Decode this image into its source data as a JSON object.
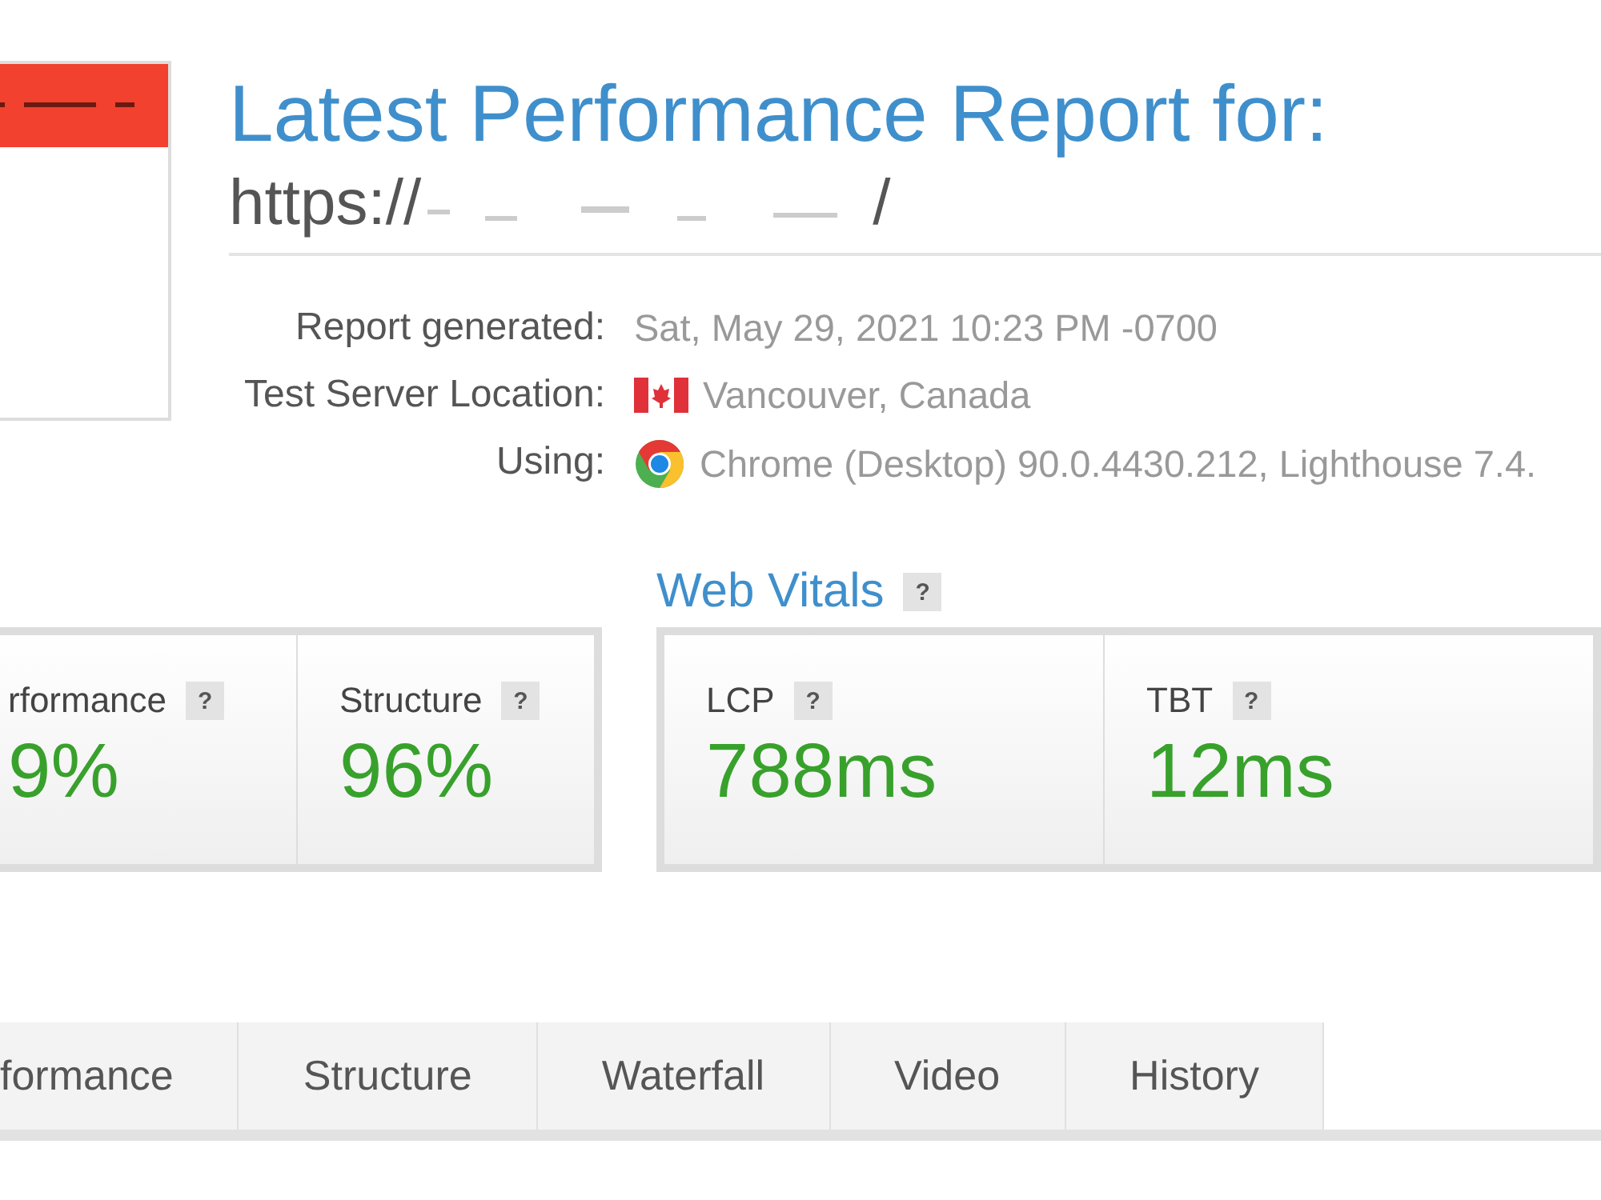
{
  "report": {
    "title": "Latest Performance Report for:",
    "url_start": "https://",
    "url_end": "/"
  },
  "details": [
    {
      "label": "Report generated:",
      "value": "Sat, May 29, 2021 10:23 PM -0700",
      "kind": "text"
    },
    {
      "label": "Test Server Location:",
      "value": "Vancouver, Canada",
      "kind": "flag"
    },
    {
      "label": "Using:",
      "value": "Chrome (Desktop) 90.0.4430.212, Lighthouse 7.4.",
      "kind": "browser"
    }
  ],
  "grades": [
    {
      "label": "rformance",
      "help": "?",
      "value": "9%"
    },
    {
      "label": "Structure",
      "help": "?",
      "value": "96%"
    }
  ],
  "web_vitals": {
    "title": "Web Vitals",
    "help": "?",
    "metrics": [
      {
        "label": "LCP",
        "help": "?",
        "value": "788ms"
      },
      {
        "label": "TBT",
        "help": "?",
        "value": "12ms"
      }
    ]
  },
  "tabs": [
    {
      "label": "formance",
      "selected": false
    },
    {
      "label": "Structure",
      "selected": false
    },
    {
      "label": "Waterfall",
      "selected": false
    },
    {
      "label": "Video",
      "selected": false
    },
    {
      "label": "History",
      "selected": false
    }
  ]
}
